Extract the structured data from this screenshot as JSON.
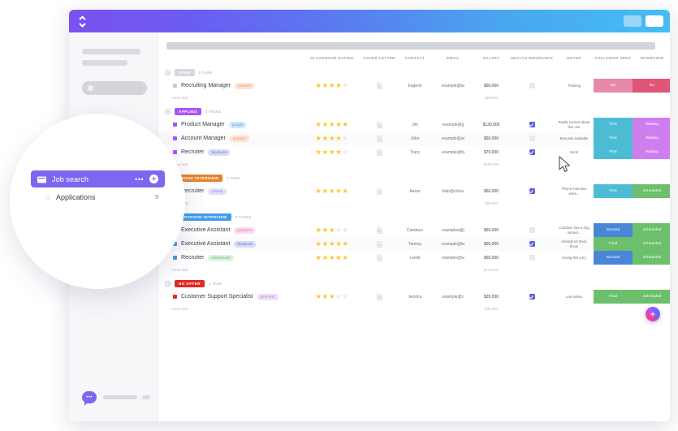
{
  "window": {
    "logo_icon": "clickup-logo-icon",
    "controls": [
      {
        "name": "minimize-button",
        "label": ""
      },
      {
        "name": "maximize-button",
        "label": ""
      }
    ]
  },
  "sidebar": {
    "chat_icon": "chat-bubble-icon",
    "chat_dots": "•••"
  },
  "table": {
    "columns": [
      {
        "key": "name",
        "label": ""
      },
      {
        "key": "rating",
        "label": "GLASSDOOR RATING"
      },
      {
        "key": "cover_letter",
        "label": "COVER LETTER"
      },
      {
        "key": "contact",
        "label": "CONTACT"
      },
      {
        "key": "email",
        "label": "EMAIL"
      },
      {
        "key": "salary",
        "label": "SALARY"
      },
      {
        "key": "health_insurance",
        "label": "HEALTH INSURANCE"
      },
      {
        "key": "notes",
        "label": "NOTES"
      },
      {
        "key": "followup",
        "label": "FOLLOWUP SENT"
      },
      {
        "key": "interview",
        "label": "INTERVIEW"
      }
    ],
    "new_task_label": "+ New task",
    "groups": [
      {
        "status": "OPEN",
        "status_color": "#d6d8de",
        "dot_color": "#c7c9d0",
        "count_label": "1 TASK",
        "subtotal": "$60,000",
        "tasks": [
          {
            "name": "Recruiting Manager",
            "chip": "amazon",
            "chip_bg": "#fde3d3",
            "chip_fg": "#e8915a",
            "rating": 4,
            "contact": "Eugene",
            "email": "example@ar",
            "salary": "$60,000",
            "health_insurance": false,
            "notes": "Thinking",
            "followup": "No",
            "followup_bg": "#e989a8",
            "interview": "No",
            "interview_bg": "#e05578"
          }
        ]
      },
      {
        "status": "APPLIED",
        "status_color": "#a855f7",
        "dot_color": "#a855f7",
        "count_label": "3 TASKS",
        "subtotal": "$260,000",
        "tasks": [
          {
            "name": "Product Manager",
            "chip": "google",
            "chip_bg": "#d5e8fb",
            "chip_fg": "#5b9bd5",
            "rating": 5,
            "contact": "Jim",
            "email": "example@g",
            "salary": "$130,000",
            "health_insurance": true,
            "notes": "Really excited about this one",
            "followup": "First",
            "followup_bg": "#4cbcd4",
            "interview": "Waiting",
            "interview_bg": "#cf7ef0"
          },
          {
            "name": "Account Manager",
            "chip": "amazon",
            "chip_bg": "#fde3d3",
            "chip_fg": "#e8915a",
            "rating": 4,
            "contact": "John",
            "email": "example@ar",
            "salary": "$60,000",
            "health_insurance": false,
            "notes": "Bonuses available",
            "followup": "First",
            "followup_bg": "#4cbcd4",
            "interview": "Waiting",
            "interview_bg": "#cf7ef0"
          },
          {
            "name": "Recruiter",
            "chip": "facebook",
            "chip_bg": "#d6ddf7",
            "chip_fg": "#5570c9",
            "rating": 4,
            "contact": "Tracy",
            "email": "example@fa",
            "salary": "$70,000",
            "health_insurance": true,
            "notes": "Sent!",
            "followup": "First",
            "followup_bg": "#4cbcd4",
            "interview": "Waiting",
            "interview_bg": "#cf7ef0"
          }
        ]
      },
      {
        "status": "PHONE INTERVIEW",
        "status_color": "#e8832b",
        "dot_color": "#e8832b",
        "count_label": "1 TASK",
        "subtotal": "$60,000",
        "tasks": [
          {
            "name": "Recruiter",
            "chip": "clickup",
            "chip_bg": "#e2e0fb",
            "chip_fg": "#8178e0",
            "rating": 5,
            "contact": "Aaron",
            "email": "help@clicku",
            "salary": "$60,000",
            "health_insurance": true,
            "notes": "Phone interview went...",
            "followup": "First",
            "followup_bg": "#4cbcd4",
            "interview": "Scheduled",
            "interview_bg": "#6cbf6b"
          }
        ]
      },
      {
        "status": "IN PERSON INTERVIEW",
        "status_color": "#3e9ce8",
        "dot_color": "#3e9ce8",
        "count_label": "3 TASKS",
        "subtotal": "$170,000",
        "tasks": [
          {
            "name": "Executive Assistant",
            "chip": "pinterest",
            "chip_bg": "#fadbef",
            "chip_fg": "#d86fb4",
            "rating": 3,
            "contact": "Candace",
            "email": "examples@j",
            "salary": "$50,000",
            "health_insurance": false,
            "notes": "Candace has a dog named...",
            "followup": "Second",
            "followup_bg": "#4a86d8",
            "interview": "Scheduled",
            "interview_bg": "#6cbf6b"
          },
          {
            "name": "Executive Assistant",
            "chip": "facebook",
            "chip_bg": "#d6ddf7",
            "chip_fg": "#5570c9",
            "rating": 5,
            "contact": "Tammy",
            "email": "example@fa",
            "salary": "$55,000",
            "health_insurance": true,
            "notes": "Already let them know",
            "followup": "Final",
            "followup_bg": "#6cbf6b",
            "interview": "Scheduled",
            "interview_bg": "#6cbf6b"
          },
          {
            "name": "Recruiter",
            "chip": "wholefoods",
            "chip_bg": "#dbf3de",
            "chip_fg": "#6aab75",
            "rating": 5,
            "contact": "Leslie",
            "email": "example@w",
            "salary": "$65,000",
            "health_insurance": false,
            "notes": "Giving this a try",
            "followup": "Second",
            "followup_bg": "#4a86d8",
            "interview": "Scheduled",
            "interview_bg": "#6cbf6b"
          }
        ]
      },
      {
        "status": "NO OFFER",
        "status_color": "#e02a23",
        "dot_color": "#e02a23",
        "count_label": "1 TASK",
        "subtotal": "$35,000",
        "tasks": [
          {
            "name": "Customer Support Specialist",
            "chip": "pinterest",
            "chip_bg": "#f0dff8",
            "chip_fg": "#b873d8",
            "rating": 3,
            "contact": "Jessica",
            "email": "example@c",
            "salary": "$35,000",
            "health_insurance": true,
            "notes": "Low salary",
            "followup": "Final",
            "followup_bg": "#6cbf6b",
            "interview": "Scheduled",
            "interview_bg": "#6cbf6b"
          }
        ]
      }
    ]
  },
  "fab": {
    "label": "+",
    "icon": "add-icon"
  },
  "magnifier": {
    "folder_icon": "folder-icon",
    "title": "Job search",
    "more_label": "•••",
    "add_label": "+",
    "sub_title": "Applications",
    "sub_count": "9"
  }
}
